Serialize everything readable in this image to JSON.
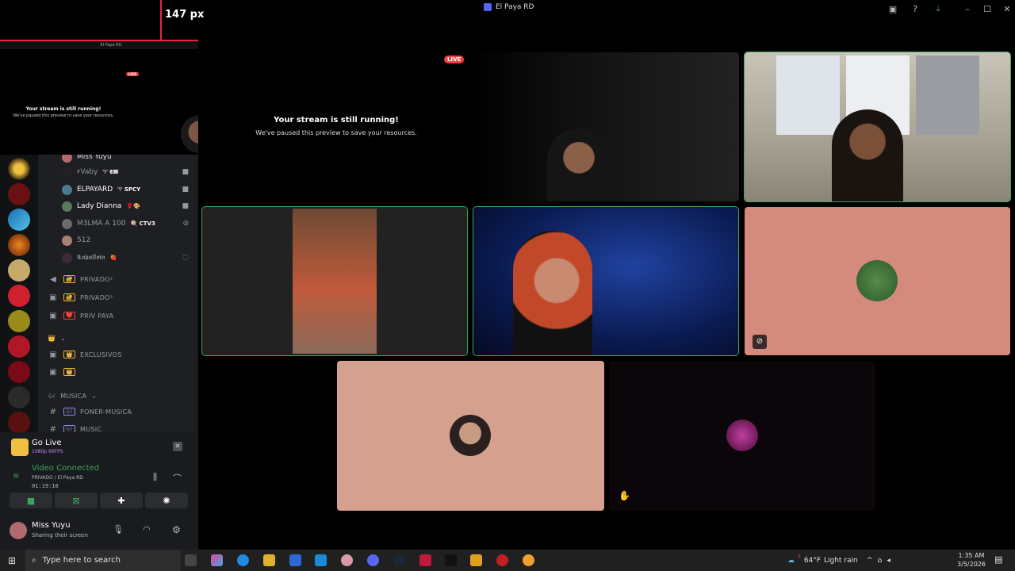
{
  "window": {
    "title": "El Paya RD"
  },
  "pip": {
    "px_label": "147 px",
    "bar_title": "El Paya RD",
    "live_badge": "LIVE",
    "paused_title": "Your stream is still running!",
    "paused_subtitle": "We've paused this preview to save your resources."
  },
  "voice_users": [
    {
      "name": "Miss Yuyu",
      "tag": ""
    },
    {
      "name": "ꜰVaby",
      "tag": "♈ 𝕮𝕸"
    },
    {
      "name": "ELPAYARD",
      "tag": "♈ SPCY"
    },
    {
      "name": "Lady Dianna",
      "tag": "🌹🎨"
    },
    {
      "name": "M3LMA A 100",
      "tag": "🍭 CTV3"
    },
    {
      "name": "512",
      "tag": ""
    },
    {
      "name": "𝕮𝖆𝖇𝖆𝖑𝖑𝖔𝖙𝖆",
      "tag": "🍓"
    }
  ],
  "channels": [
    {
      "icon": "speaker",
      "label": "PRIVADO²",
      "emoji": "🔐"
    },
    {
      "icon": "lock",
      "label": "PRIVADO³",
      "emoji": "🔐"
    },
    {
      "icon": "lock",
      "label": "PRIV PAYA",
      "emoji": "❤️"
    },
    {
      "icon": "category",
      "label": "",
      "emoji": "👑"
    },
    {
      "icon": "lock",
      "label": "EXCLUSIVOS",
      "emoji": "👑"
    },
    {
      "icon": "lock",
      "label": "",
      "emoji": "👑"
    },
    {
      "icon": "category",
      "label": "MUSICA",
      "emoji": "🎶"
    },
    {
      "icon": "hash",
      "label": "PONER-MUSICA",
      "emoji": "🎶"
    },
    {
      "icon": "hash",
      "label": "MUSIC",
      "emoji": "🎶"
    }
  ],
  "go_live": {
    "title": "Go Live",
    "quality": "1080p 60FPS"
  },
  "voice_status": {
    "title": "Video Connected",
    "channel": "PRIVADO / El Paya RD",
    "timer": "01:19:16"
  },
  "user": {
    "name": "Miss Yuyu",
    "status": "Sharing their screen"
  },
  "stage": {
    "live_badge": "LIVE",
    "paused_title": "Your stream is still running!",
    "paused_subtitle": "We've paused this preview to save your resources."
  },
  "taskbar": {
    "search_placeholder": "Type here to search",
    "weather_temp": "64°F",
    "weather_desc": "Light rain",
    "weather_badge": "2",
    "time": "1:35 AM",
    "date": "3/5/2026"
  },
  "colors": {
    "accent": "#5865f2",
    "speaking": "#3ba55c",
    "live": "#ed4245",
    "tile_salmon": "#d48a7c",
    "tile_peach": "#d6a08e"
  }
}
